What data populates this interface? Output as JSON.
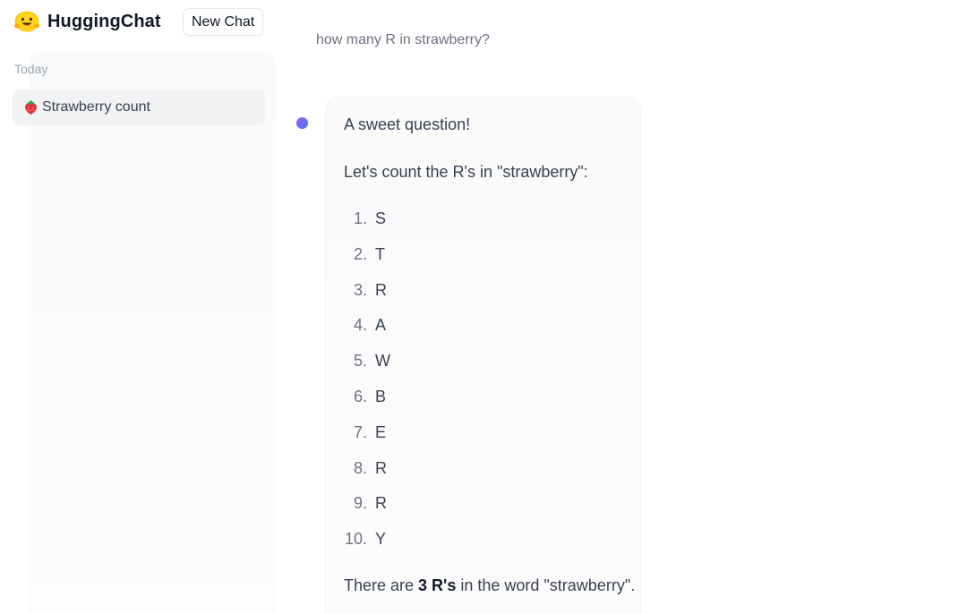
{
  "app": {
    "name": "HuggingChat",
    "logo_icon": "hugging-face-emoji-icon",
    "new_chat_label": "New Chat"
  },
  "sidebar": {
    "section_label": "Today",
    "conversations": [
      {
        "emoji_icon": "strawberry-icon",
        "label": "Strawberry count"
      }
    ]
  },
  "chat": {
    "user_message": "how many R in strawberry?",
    "assistant": {
      "avatar_colors": [
        "#a855f7",
        "#3b82f6"
      ],
      "intro": "A sweet question!",
      "lead": "Let's count the R's in \"strawberry\":",
      "letters": [
        {
          "num": "1.",
          "val": "S"
        },
        {
          "num": "2.",
          "val": "T"
        },
        {
          "num": "3.",
          "val": "R"
        },
        {
          "num": "4.",
          "val": "A"
        },
        {
          "num": "5.",
          "val": "W"
        },
        {
          "num": "6.",
          "val": "B"
        },
        {
          "num": "7.",
          "val": "E"
        },
        {
          "num": "8.",
          "val": "R"
        },
        {
          "num": "9.",
          "val": "R"
        },
        {
          "num": "10.",
          "val": "Y"
        }
      ],
      "conclusion_pre": "There are ",
      "conclusion_bold": "3 R's",
      "conclusion_post": " in the word \"strawberry\"."
    }
  }
}
